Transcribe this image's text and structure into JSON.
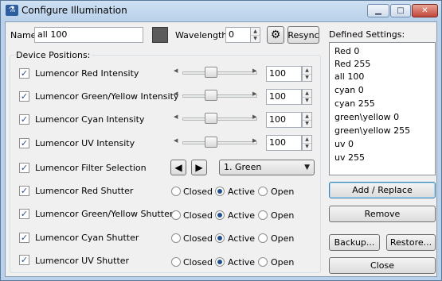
{
  "window": {
    "title": "Configure Illumination",
    "minimize_icon": "minimize-icon",
    "maximize_icon": "maximize-icon",
    "close_icon": "close-icon"
  },
  "top": {
    "name_label": "Name:",
    "name_value": "all 100",
    "wavelength_label": "Wavelength:",
    "wavelength_value": "0",
    "resync_label": "Resync",
    "color_swatch": "#5b5b5b"
  },
  "device_positions": {
    "group_label": "Device Positions:",
    "intensities": [
      {
        "label": "Lumencor Red Intensity",
        "value": "100",
        "slider_fraction": 0.5
      },
      {
        "label": "Lumencor Green/Yellow Intensity",
        "value": "100",
        "slider_fraction": 0.5
      },
      {
        "label": "Lumencor Cyan Intensity",
        "value": "100",
        "slider_fraction": 0.5
      },
      {
        "label": "Lumencor UV Intensity",
        "value": "100",
        "slider_fraction": 0.5
      }
    ],
    "filter": {
      "label": "Lumencor Filter Selection",
      "selected": "1. Green"
    },
    "shutters": [
      {
        "label": "Lumencor Red Shutter",
        "selected": "Active"
      },
      {
        "label": "Lumencor Green/Yellow Shutter",
        "selected": "Active"
      },
      {
        "label": "Lumencor Cyan Shutter",
        "selected": "Active"
      },
      {
        "label": "Lumencor UV Shutter",
        "selected": "Active"
      }
    ],
    "radio_options": [
      "Closed",
      "Active",
      "Open"
    ]
  },
  "defined_settings": {
    "label": "Defined Settings:",
    "items": [
      "Red 0",
      "Red 255",
      "all 100",
      "cyan 0",
      "cyan 255",
      "green\\yellow 0",
      "green\\yellow 255",
      "uv 0",
      "uv 255"
    ]
  },
  "buttons": {
    "add_replace": "Add / Replace",
    "remove": "Remove",
    "backup": "Backup...",
    "restore": "Restore...",
    "close": "Close"
  }
}
